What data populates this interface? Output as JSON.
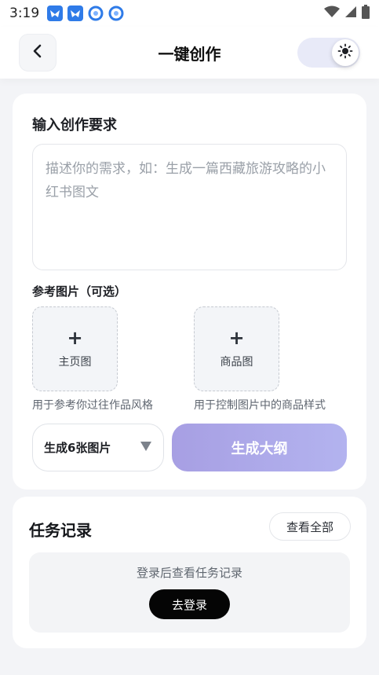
{
  "status_bar": {
    "time": "3:19",
    "notification_icons": [
      "bird-app-icon",
      "bird-app-icon",
      "app-circle-icon",
      "app-circle-icon"
    ],
    "right_icons": [
      "wifi-icon",
      "signal-icon",
      "battery-icon"
    ]
  },
  "header": {
    "title": "一键创作",
    "back_icon": "chevron-left-icon",
    "theme_icon": "sun-icon"
  },
  "create": {
    "section_title": "输入创作要求",
    "prompt_placeholder": "描述你的需求，如：生成一篇西藏旅游攻略的小红书图文",
    "prompt_value": "",
    "reference_title": "参考图片（可选）",
    "slots": [
      {
        "plus": "+",
        "label": "主页图",
        "hint": "用于参考你过往作品风格"
      },
      {
        "plus": "+",
        "label": "商品图",
        "hint": "用于控制图片中的商品样式"
      }
    ],
    "count_select": "生成6张图片",
    "generate_label": "生成大纲"
  },
  "tasks": {
    "title": "任务记录",
    "view_all": "查看全部",
    "empty_text": "登录后查看任务记录",
    "login_label": "去登录"
  },
  "colors": {
    "accent_gradient_start": "#a79fe3",
    "accent_gradient_end": "#b3b3ef",
    "login_button": "#050505"
  }
}
